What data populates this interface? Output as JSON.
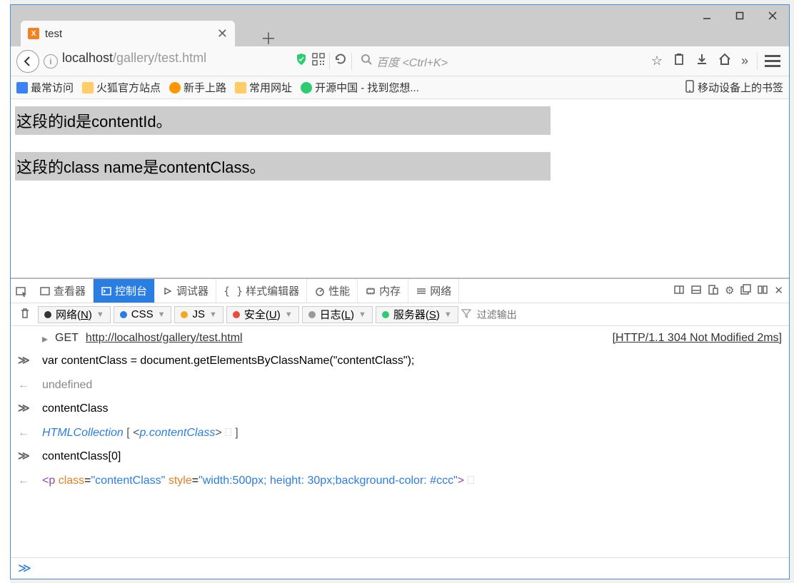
{
  "tab": {
    "title": "test",
    "favicon_label": "X"
  },
  "url": {
    "host": "localhost",
    "path": "/gallery/test.html"
  },
  "search": {
    "placeholder": "百度 <Ctrl+K>"
  },
  "bookmarks": {
    "most_visited": "最常访问",
    "firefox_official": "火狐官方站点",
    "getting_started": "新手上路",
    "common_sites": "常用网址",
    "oschina": "开源中国 - 找到您想...",
    "mobile": "移动设备上的书签"
  },
  "page": {
    "para1": "这段的id是contentId。",
    "para2": "这段的class name是contentClass。"
  },
  "devtools": {
    "tabs": {
      "inspector": "查看器",
      "console": "控制台",
      "debugger": "调试器",
      "style": "样式编辑器",
      "perf": "性能",
      "memory": "内存",
      "network": "网络"
    },
    "filters": {
      "net": "网络",
      "net_key": "N",
      "css": "CSS",
      "js": "JS",
      "security": "安全",
      "security_key": "U",
      "log": "日志",
      "log_key": "L",
      "server": "服务器",
      "server_key": "S",
      "filter_placeholder": "过滤输出"
    },
    "console": {
      "net_method": "GET",
      "net_url": "http://localhost/gallery/test.html",
      "net_status": "[HTTP/1.1 304 Not Modified 2ms]",
      "line1": "var contentClass = document.getElementsByClassName(\"contentClass\");",
      "line2": "undefined",
      "line3": "contentClass",
      "line4_obj": "HTMLCollection",
      "line4_open": " [ <",
      "line4_cls": "p.contentClass",
      "line4_close": "> ",
      "line4_end": " ]",
      "line5": "contentClass[0]",
      "line6_tag_open": "<",
      "line6_tag": "p",
      "line6_sp1": " ",
      "line6_attr1": "class",
      "line6_eq": "=",
      "line6_val1": "\"contentClass\"",
      "line6_sp2": " ",
      "line6_attr2": "style",
      "line6_val2": "\"width:500px; height: 30px;background-color: #ccc\"",
      "line6_tag_close": ">"
    }
  }
}
